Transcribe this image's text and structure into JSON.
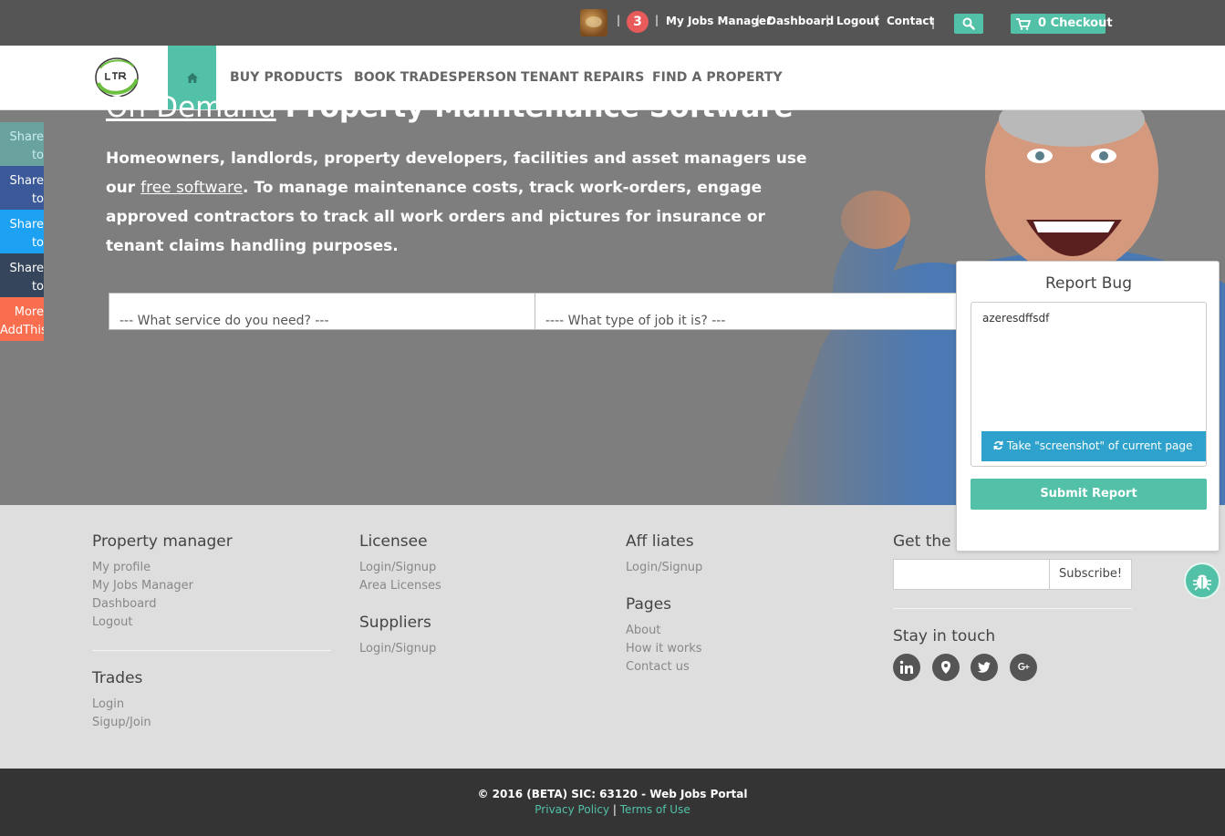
{
  "topbar": {
    "notification_count": "3",
    "separator": "|",
    "links": [
      "My Jobs Manager",
      "Dashboard",
      "Logout",
      "Contact"
    ],
    "checkout_label": "0 Checkout"
  },
  "nav": {
    "items": [
      "BUY PRODUCTS",
      "BOOK TRADESPERSON",
      "TENANT REPAIRS",
      "FIND A PROPERTY"
    ]
  },
  "sidebar": {
    "share_items": [
      {
        "label": "Share to Pinterest",
        "color": "#6aa39d"
      },
      {
        "label": "Share to Facebook",
        "color": "#3b5998"
      },
      {
        "label": "Share to Twitter",
        "color": "#1da1f2"
      },
      {
        "label": "Share to Tumblr",
        "color": "#35465c"
      },
      {
        "label": "More AddThis",
        "color": "#f96e4f"
      }
    ]
  },
  "hero": {
    "title_link": "On-Demand",
    "title_rest": "Property Maintenance Software",
    "text_before": "Homeowners, landlords, property developers, facilities and asset managers use our",
    "text_link": "free software",
    "text_after": ". To manage maintenance costs, track work-orders, engage approved contractors to track all work orders and pictures for insurance or tenant claims handling purposes.",
    "select_service": "--- What service do you need? ---",
    "select_job": "---- What type of job it is? ---"
  },
  "bug_report": {
    "title": "Report Bug",
    "text": "azeresdffsdf",
    "screenshot_label": "Take \"screenshot\" of current page",
    "submit_label": "Submit Report"
  },
  "footer": {
    "property_manager": {
      "heading": "Property manager",
      "links": [
        "My profile",
        "My Jobs Manager",
        "Dashboard",
        "Logout"
      ]
    },
    "trades": {
      "heading": "Trades",
      "links": [
        "Login",
        "Sigup/Join"
      ]
    },
    "licensee": {
      "heading": "Licensee",
      "links": [
        "Login/Signup",
        "Area Licenses"
      ]
    },
    "suppliers": {
      "heading": "Suppliers",
      "links": [
        "Login/Signup"
      ]
    },
    "affiliates": {
      "heading": "Aff liates",
      "links": [
        "Login/Signup"
      ]
    },
    "pages": {
      "heading": "Pages",
      "links": [
        "About",
        "How it works",
        "Contact us"
      ]
    },
    "newsletter": {
      "heading": "Get the n",
      "button": "Subscribe!"
    },
    "stay_in_touch": "Stay in touch",
    "social_icons": [
      "linkedin-icon",
      "location-icon",
      "twitter-icon",
      "google-plus-icon"
    ]
  },
  "bottom": {
    "copyright": "© 2016 (BETA) SIC: 63120 - Web Jobs Portal",
    "privacy": "Privacy Policy",
    "sep": "|",
    "terms": "Terms of Use"
  },
  "colors": {
    "accent": "#52c1a7",
    "topbar": "#555555",
    "footer_bottom": "#343434",
    "badge": "#e95a5a"
  }
}
